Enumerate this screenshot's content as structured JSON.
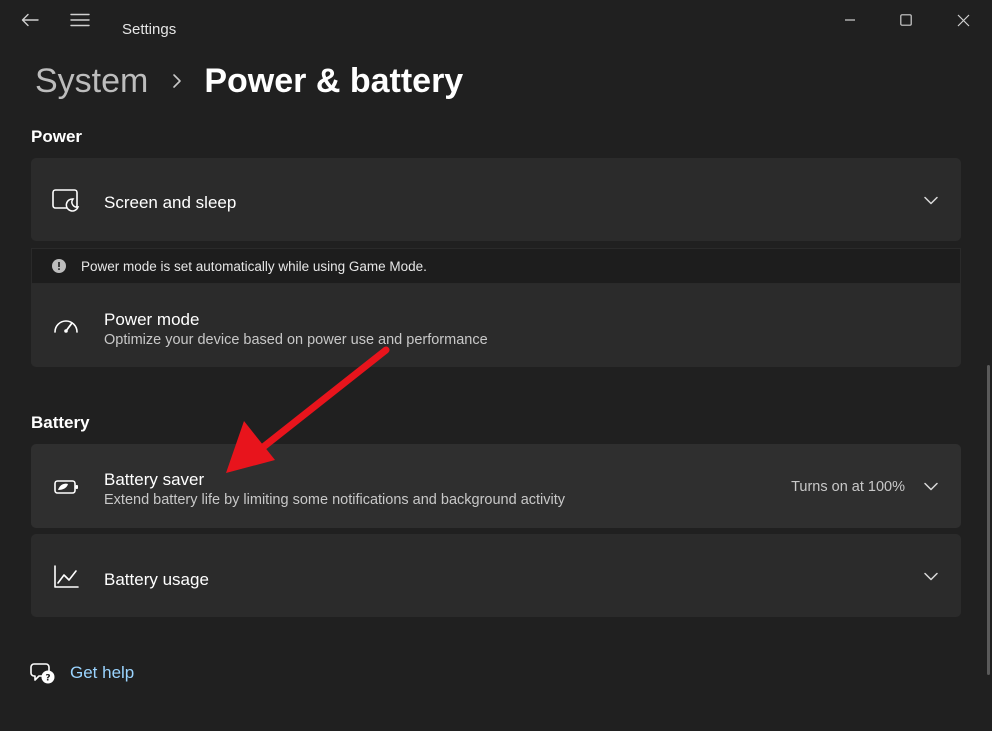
{
  "window": {
    "title": "Settings"
  },
  "breadcrumb": {
    "parent": "System",
    "current": "Power & battery"
  },
  "sections": {
    "power": {
      "header": "Power",
      "screen_sleep": {
        "title": "Screen and sleep"
      },
      "notice": "Power mode is set automatically while using Game Mode.",
      "power_mode": {
        "title": "Power mode",
        "description": "Optimize your device based on power use and performance"
      }
    },
    "battery": {
      "header": "Battery",
      "battery_saver": {
        "title": "Battery saver",
        "description": "Extend battery life by limiting some notifications and background activity",
        "status": "Turns on at 100%"
      },
      "battery_usage": {
        "title": "Battery usage"
      }
    }
  },
  "help": {
    "label": "Get help"
  },
  "colors": {
    "background": "#202020",
    "card": "#2b2b2b",
    "accent_link": "#9ad4ff",
    "annotation_arrow": "#e8141c"
  }
}
